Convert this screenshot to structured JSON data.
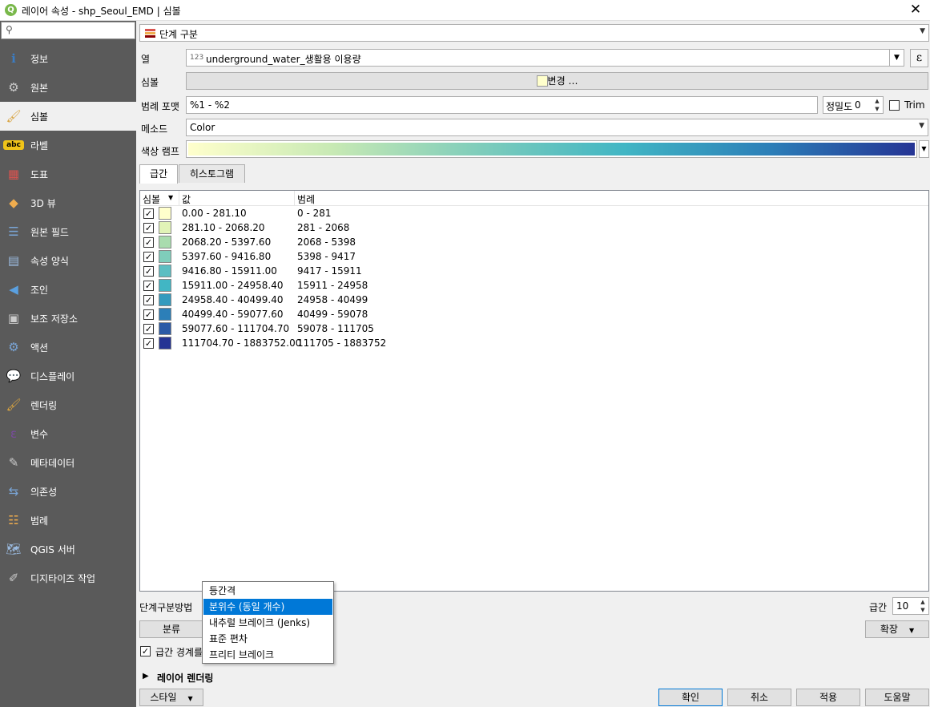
{
  "window": {
    "title": "레이어 속성 - shp_Seoul_EMD | 심볼",
    "logo": "Q"
  },
  "sidebar": {
    "search_placeholder": "",
    "items": [
      {
        "label": "정보",
        "icon": "info-icon"
      },
      {
        "label": "원본",
        "icon": "source-icon"
      },
      {
        "label": "심볼",
        "icon": "symbology-icon"
      },
      {
        "label": "라벨",
        "icon": "labels-icon"
      },
      {
        "label": "도표",
        "icon": "diagram-icon"
      },
      {
        "label": "3D 뷰",
        "icon": "3d-view-icon"
      },
      {
        "label": "원본 필드",
        "icon": "source-fields-icon"
      },
      {
        "label": "속성 양식",
        "icon": "attributes-form-icon"
      },
      {
        "label": "조인",
        "icon": "joins-icon"
      },
      {
        "label": "보조 저장소",
        "icon": "auxiliary-storage-icon"
      },
      {
        "label": "액션",
        "icon": "actions-icon"
      },
      {
        "label": "디스플레이",
        "icon": "display-icon"
      },
      {
        "label": "렌더링",
        "icon": "rendering-icon"
      },
      {
        "label": "변수",
        "icon": "variables-icon"
      },
      {
        "label": "메타데이터",
        "icon": "metadata-icon"
      },
      {
        "label": "의존성",
        "icon": "dependencies-icon"
      },
      {
        "label": "범례",
        "icon": "legend-icon"
      },
      {
        "label": "QGIS 서버",
        "icon": "qgis-server-icon"
      },
      {
        "label": "디지타이즈 작업",
        "icon": "digitizing-icon"
      }
    ],
    "active_index": 2
  },
  "renderer": {
    "value": "단계 구분"
  },
  "column": {
    "label": "열",
    "type_badge": "123",
    "value": "underground_water_생활용 이용량"
  },
  "symbol": {
    "label": "심볼",
    "button": "변경 …",
    "color": "#ffffcc"
  },
  "legend_format": {
    "label": "범례 포맷",
    "value": "%1 - %2",
    "precision_label": "정밀도",
    "precision_value": "0",
    "trim_label": "Trim"
  },
  "method": {
    "label": "메소드",
    "value": "Color"
  },
  "color_ramp": {
    "label": "색상 램프"
  },
  "tabs": [
    "급간",
    "히스토그램"
  ],
  "table": {
    "headers": {
      "symbol": "심볼",
      "value": "값",
      "legend": "범례"
    },
    "rows": [
      {
        "value": "0.00 - 281.10",
        "legend": "0 - 281",
        "color": "#ffffcc"
      },
      {
        "value": "281.10 - 2068.20",
        "legend": "281 - 2068",
        "color": "#e1f3b7"
      },
      {
        "value": "2068.20 - 5397.60",
        "legend": "2068 - 5398",
        "color": "#a9dcae"
      },
      {
        "value": "5397.60 - 9416.80",
        "legend": "5398 - 9417",
        "color": "#7fcdbb"
      },
      {
        "value": "9416.80 - 15911.00",
        "legend": "9417 - 15911",
        "color": "#5bbec2"
      },
      {
        "value": "15911.00 - 24958.40",
        "legend": "15911 - 24958",
        "color": "#41b6c4"
      },
      {
        "value": "24958.40 - 40499.40",
        "legend": "24958 - 40499",
        "color": "#349bbe"
      },
      {
        "value": "40499.40 - 59077.60",
        "legend": "40499 - 59078",
        "color": "#2c7fb8"
      },
      {
        "value": "59077.60 - 111704.70",
        "legend": "59078 - 111705",
        "color": "#2b5aa6"
      },
      {
        "value": "111704.70 - 1883752.00",
        "legend": "111705 - 1883752",
        "color": "#253494"
      }
    ]
  },
  "mode": {
    "label": "단계구분방법"
  },
  "mode_popup": {
    "items": [
      "등간격",
      "분위수 (동일 개수)",
      "내추럴 브레이크 (Jenks)",
      "표준 편차",
      "프리티 브레이크"
    ],
    "selected_index": 1
  },
  "classes": {
    "label": "급간",
    "value": "10"
  },
  "buttons": {
    "classify": "분류",
    "advanced": "확장",
    "style": "스타일",
    "ok": "확인",
    "cancel": "취소",
    "apply": "적용",
    "help": "도움말"
  },
  "link_class": {
    "label": "급간 경계를"
  },
  "layer_rendering": {
    "label": "레이어 렌더링"
  }
}
